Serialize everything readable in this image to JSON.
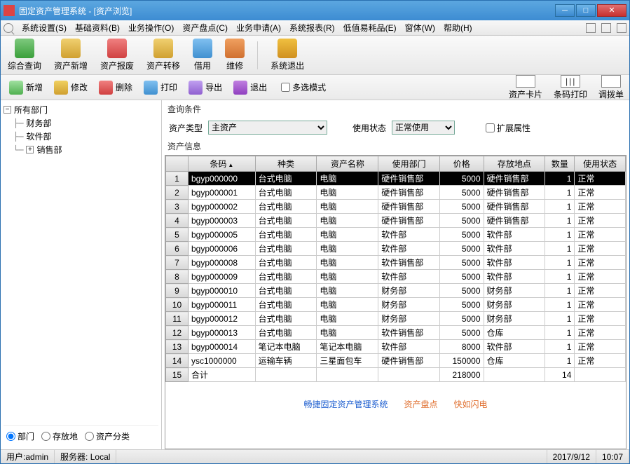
{
  "window_title": "固定资产管理系统 - [资产浏览]",
  "menus": [
    "系统设置(S)",
    "基础资料(B)",
    "业务操作(O)",
    "资产盘点(C)",
    "业务申请(A)",
    "系统报表(R)",
    "低值易耗品(E)",
    "窗体(W)",
    "帮助(H)"
  ],
  "toolbar": [
    {
      "label": "综合查询",
      "cls": "tl1"
    },
    {
      "label": "资产新增",
      "cls": "tl2"
    },
    {
      "label": "资产报废",
      "cls": "tl3"
    },
    {
      "label": "资产转移",
      "cls": "tl4"
    },
    {
      "label": "借用",
      "cls": "tl5"
    },
    {
      "label": "维修",
      "cls": "tl6"
    },
    {
      "sep": true
    },
    {
      "label": "系统退出",
      "cls": "tl7"
    }
  ],
  "actions": [
    {
      "label": "新增",
      "cls": "a1"
    },
    {
      "label": "修改",
      "cls": "a2"
    },
    {
      "label": "删除",
      "cls": "a3"
    },
    {
      "label": "打印",
      "cls": "a4"
    },
    {
      "label": "导出",
      "cls": "a5"
    },
    {
      "label": "退出",
      "cls": "a6"
    }
  ],
  "multi_select_label": "多选模式",
  "right_buttons": [
    "资产卡片",
    "条码打印",
    "调拨单"
  ],
  "tree_root": "所有部门",
  "tree_children": [
    "财务部",
    "软件部",
    "销售部"
  ],
  "radios": [
    "部门",
    "存放地",
    "资产分类"
  ],
  "query_section": "查询条件",
  "asset_type_label": "资产类型",
  "asset_type_value": "主资产",
  "use_status_label": "使用状态",
  "use_status_value": "正常使用",
  "extend_attr_label": "扩展属性",
  "info_section": "资产信息",
  "columns": [
    "条码",
    "种类",
    "资产名称",
    "使用部门",
    "价格",
    "存放地点",
    "数量",
    "使用状态"
  ],
  "rows": [
    {
      "n": 1,
      "code": "bgyp000000",
      "kind": "台式电脑",
      "name": "电脑",
      "dept": "硬件销售部",
      "price": "5000",
      "loc": "硬件销售部",
      "qty": "1",
      "stat": "正常",
      "sel": true
    },
    {
      "n": 2,
      "code": "bgyp000001",
      "kind": "台式电脑",
      "name": "电脑",
      "dept": "硬件销售部",
      "price": "5000",
      "loc": "硬件销售部",
      "qty": "1",
      "stat": "正常"
    },
    {
      "n": 3,
      "code": "bgyp000002",
      "kind": "台式电脑",
      "name": "电脑",
      "dept": "硬件销售部",
      "price": "5000",
      "loc": "硬件销售部",
      "qty": "1",
      "stat": "正常"
    },
    {
      "n": 4,
      "code": "bgyp000003",
      "kind": "台式电脑",
      "name": "电脑",
      "dept": "硬件销售部",
      "price": "5000",
      "loc": "硬件销售部",
      "qty": "1",
      "stat": "正常"
    },
    {
      "n": 5,
      "code": "bgyp000005",
      "kind": "台式电脑",
      "name": "电脑",
      "dept": "软件部",
      "price": "5000",
      "loc": "软件部",
      "qty": "1",
      "stat": "正常"
    },
    {
      "n": 6,
      "code": "bgyp000006",
      "kind": "台式电脑",
      "name": "电脑",
      "dept": "软件部",
      "price": "5000",
      "loc": "软件部",
      "qty": "1",
      "stat": "正常"
    },
    {
      "n": 7,
      "code": "bgyp000008",
      "kind": "台式电脑",
      "name": "电脑",
      "dept": "软件销售部",
      "price": "5000",
      "loc": "软件部",
      "qty": "1",
      "stat": "正常"
    },
    {
      "n": 8,
      "code": "bgyp000009",
      "kind": "台式电脑",
      "name": "电脑",
      "dept": "软件部",
      "price": "5000",
      "loc": "软件部",
      "qty": "1",
      "stat": "正常"
    },
    {
      "n": 9,
      "code": "bgyp000010",
      "kind": "台式电脑",
      "name": "电脑",
      "dept": "财务部",
      "price": "5000",
      "loc": "财务部",
      "qty": "1",
      "stat": "正常"
    },
    {
      "n": 10,
      "code": "bgyp000011",
      "kind": "台式电脑",
      "name": "电脑",
      "dept": "财务部",
      "price": "5000",
      "loc": "财务部",
      "qty": "1",
      "stat": "正常"
    },
    {
      "n": 11,
      "code": "bgyp000012",
      "kind": "台式电脑",
      "name": "电脑",
      "dept": "财务部",
      "price": "5000",
      "loc": "财务部",
      "qty": "1",
      "stat": "正常"
    },
    {
      "n": 12,
      "code": "bgyp000013",
      "kind": "台式电脑",
      "name": "电脑",
      "dept": "软件销售部",
      "price": "5000",
      "loc": "仓库",
      "qty": "1",
      "stat": "正常"
    },
    {
      "n": 13,
      "code": "bgyp000014",
      "kind": "笔记本电脑",
      "name": "笔记本电脑",
      "dept": "软件部",
      "price": "8000",
      "loc": "软件部",
      "qty": "1",
      "stat": "正常"
    },
    {
      "n": 14,
      "code": "ysc1000000",
      "kind": "运输车辆",
      "name": "三星面包车",
      "dept": "硬件销售部",
      "price": "150000",
      "loc": "仓库",
      "qty": "1",
      "stat": "正常"
    },
    {
      "n": 15,
      "code": "合计",
      "kind": "",
      "name": "",
      "dept": "",
      "price": "218000",
      "loc": "",
      "qty": "14",
      "stat": ""
    }
  ],
  "promo": {
    "p1": "畅捷固定资产管理系统",
    "p2": "资产盘点",
    "p3": "快如闪电"
  },
  "status": {
    "user_label": "用户:",
    "user": "admin",
    "server_label": "服务器:",
    "server": "Local",
    "date": "2017/9/12",
    "time": "10:07"
  }
}
